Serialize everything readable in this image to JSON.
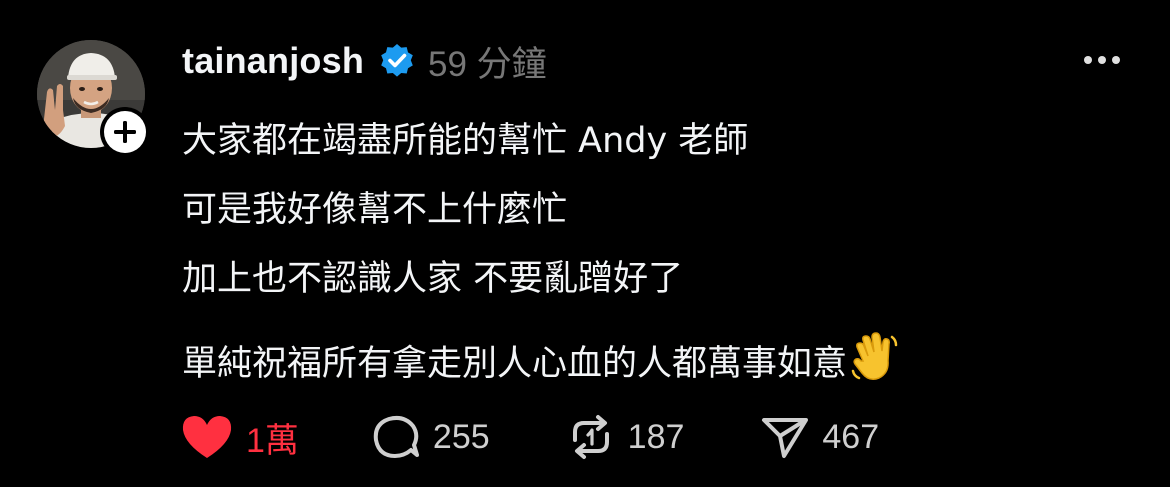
{
  "post": {
    "username": "tainanjosh",
    "timestamp": "59 分鐘",
    "lines": [
      "大家都在竭盡所能的幫忙 Andy 老師",
      "可是我好像幫不上什麼忙",
      "加上也不認識人家 不要亂蹭好了",
      "單純祝福所有拿走別人心血的人都萬事如意"
    ],
    "emoji": "waving-hand"
  },
  "actions": {
    "likes": "1萬",
    "replies": "255",
    "reposts": "187",
    "shares": "467"
  },
  "colors": {
    "background": "#000000",
    "text": "#f3f5f7",
    "muted": "#777777",
    "like": "#ff3040",
    "verified": "#1d9bf0"
  },
  "icons": {
    "verified": "verified-badge-icon",
    "follow": "plus-icon",
    "more": "more-icon",
    "like": "heart-icon",
    "reply": "comment-icon",
    "repost": "repost-icon",
    "share": "send-icon"
  }
}
